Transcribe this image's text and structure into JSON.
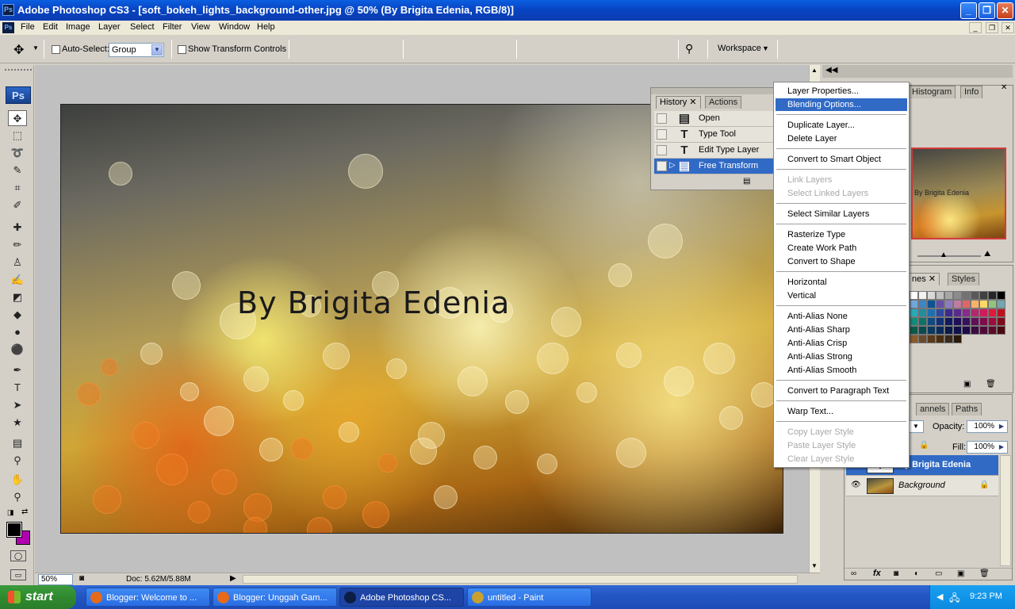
{
  "window": {
    "title": "Adobe Photoshop CS3 - [soft_bokeh_lights_background-other.jpg @ 50% (By Brigita Edenia, RGB/8)]",
    "app_icon_text": "Ps",
    "min_glyph": "_",
    "max_glyph": "❐",
    "close_glyph": "✕"
  },
  "menu": {
    "items": [
      "File",
      "Edit",
      "Image",
      "Layer",
      "Select",
      "Filter",
      "View",
      "Window",
      "Help"
    ],
    "doc_icon_text": "Ps"
  },
  "options": {
    "auto_select_label": "Auto-Select:",
    "auto_select_value": "Group",
    "transform_label": "Show Transform Controls",
    "workspace_label": "Workspace"
  },
  "toolbox": {
    "logo": "Ps",
    "tools": [
      {
        "name": "move-tool",
        "glyph": "✥"
      },
      {
        "name": "marquee-tool",
        "glyph": "⬚"
      },
      {
        "name": "lasso-tool",
        "glyph": "➰"
      },
      {
        "name": "quick-select-tool",
        "glyph": "✎"
      },
      {
        "name": "crop-tool",
        "glyph": "⌗"
      },
      {
        "name": "slice-tool",
        "glyph": "✐"
      },
      {
        "name": "healing-tool",
        "glyph": "✚"
      },
      {
        "name": "brush-tool",
        "glyph": "✏"
      },
      {
        "name": "stamp-tool",
        "glyph": "♙"
      },
      {
        "name": "history-brush-tool",
        "glyph": "✍"
      },
      {
        "name": "eraser-tool",
        "glyph": "◩"
      },
      {
        "name": "paint-bucket-tool",
        "glyph": "◆"
      },
      {
        "name": "blur-tool",
        "glyph": "●"
      },
      {
        "name": "dodge-tool",
        "glyph": "⚫"
      },
      {
        "name": "pen-tool",
        "glyph": "✒"
      },
      {
        "name": "type-tool",
        "glyph": "T"
      },
      {
        "name": "path-select-tool",
        "glyph": "➤"
      },
      {
        "name": "shape-tool",
        "glyph": "★"
      },
      {
        "name": "notes-tool",
        "glyph": "▤"
      },
      {
        "name": "eyedropper-tool",
        "glyph": "⚲"
      },
      {
        "name": "hand-tool",
        "glyph": "✋"
      },
      {
        "name": "zoom-tool",
        "glyph": "⚲"
      }
    ],
    "foreground_color": "#000000",
    "background_color": "#b000b0"
  },
  "canvas": {
    "caption": "By Brigita Edenia"
  },
  "status": {
    "zoom": "50%",
    "doc": "Doc: 5.62M/5.88M"
  },
  "history": {
    "tabs": [
      "History",
      "Actions"
    ],
    "close_glyph": "✕",
    "rows": [
      {
        "label": "Open",
        "icon": "▤",
        "selected": false
      },
      {
        "label": "Type Tool",
        "icon": "T",
        "selected": false
      },
      {
        "label": "Edit Type Layer",
        "icon": "T",
        "selected": false
      },
      {
        "label": "Free Transform",
        "icon": "▤",
        "selected": true
      }
    ]
  },
  "context_menu": {
    "items": [
      {
        "label": "Layer Properties...",
        "state": "normal"
      },
      {
        "label": "Blending Options...",
        "state": "selected"
      },
      {
        "sep": true
      },
      {
        "label": "Duplicate Layer...",
        "state": "normal"
      },
      {
        "label": "Delete Layer",
        "state": "normal"
      },
      {
        "sep": true
      },
      {
        "label": "Convert to Smart Object",
        "state": "normal"
      },
      {
        "sep": true
      },
      {
        "label": "Link Layers",
        "state": "disabled"
      },
      {
        "label": "Select Linked Layers",
        "state": "disabled"
      },
      {
        "sep": true
      },
      {
        "label": "Select Similar Layers",
        "state": "normal"
      },
      {
        "sep": true
      },
      {
        "label": "Rasterize Type",
        "state": "normal"
      },
      {
        "label": "Create Work Path",
        "state": "normal"
      },
      {
        "label": "Convert to Shape",
        "state": "normal"
      },
      {
        "sep": true
      },
      {
        "label": "Horizontal",
        "state": "normal"
      },
      {
        "label": "Vertical",
        "state": "normal"
      },
      {
        "sep": true
      },
      {
        "label": "Anti-Alias None",
        "state": "normal"
      },
      {
        "label": "Anti-Alias Sharp",
        "state": "normal"
      },
      {
        "label": "Anti-Alias Crisp",
        "state": "normal"
      },
      {
        "label": "Anti-Alias Strong",
        "state": "normal"
      },
      {
        "label": "Anti-Alias Smooth",
        "state": "normal"
      },
      {
        "sep": true
      },
      {
        "label": "Convert to Paragraph Text",
        "state": "normal"
      },
      {
        "sep": true
      },
      {
        "label": "Warp Text...",
        "state": "normal"
      },
      {
        "sep": true
      },
      {
        "label": "Copy Layer Style",
        "state": "disabled"
      },
      {
        "label": "Paste Layer Style",
        "state": "disabled"
      },
      {
        "label": "Clear Layer Style",
        "state": "disabled"
      }
    ]
  },
  "navigator": {
    "tabs": [
      "Histogram",
      "Info"
    ],
    "thumb_caption": "By Brigita Edenia"
  },
  "swatches": {
    "tabs": [
      "nes",
      "Styles"
    ],
    "close_glyph": "✕",
    "colors": [
      "#ffffff",
      "#f2f2f2",
      "#d9d9d9",
      "#bfbfbf",
      "#a6a6a6",
      "#8c8c8c",
      "#737373",
      "#595959",
      "#404040",
      "#262626",
      "#000000",
      "#6fa8dc",
      "#3d85c6",
      "#0b5394",
      "#674ea7",
      "#8e7cc3",
      "#c27ba0",
      "#e06666",
      "#f6b26b",
      "#ffd966",
      "#93c47d",
      "#76a5af",
      "#2aa8b8",
      "#1f8ea0",
      "#1e6fb0",
      "#2c4aa0",
      "#3d2a90",
      "#5a2a8c",
      "#8a2a8c",
      "#b02a6c",
      "#d01a5a",
      "#e01a3a",
      "#c01020",
      "#148a7a",
      "#10706a",
      "#104a80",
      "#10307a",
      "#101a60",
      "#20105a",
      "#3a1060",
      "#60105a",
      "#800a4a",
      "#a00a3a",
      "#800a1a",
      "#0a5a4a",
      "#0a4a50",
      "#0a3a60",
      "#0a2a5a",
      "#0a1a4a",
      "#10104a",
      "#200a4a",
      "#3a0a40",
      "#500a3a",
      "#600a2a",
      "#4a0a10",
      "#8a5a2a",
      "#6a4a2a",
      "#5a3a1a",
      "#4a3010",
      "#3a2a1a",
      "#2a1a0a"
    ]
  },
  "layers": {
    "tabs": [
      "annels",
      "Paths"
    ],
    "opacity_label": "Opacity:",
    "opacity_value": "100%",
    "fill_label": "Fill:",
    "fill_value": "100%",
    "rows": [
      {
        "name": "By Brigita Edenia",
        "type": "text",
        "selected": true
      },
      {
        "name": "Background",
        "type": "image",
        "selected": false
      }
    ],
    "bottom_icons": [
      "link-icon",
      "fx-icon",
      "mask-icon",
      "adjustment-icon",
      "folder-icon",
      "new-layer-icon",
      "trash-icon"
    ]
  },
  "taskbar": {
    "start_label": "start",
    "buttons": [
      {
        "label": "Blogger: Welcome to ...",
        "icon_color": "#e66a1a",
        "active": false
      },
      {
        "label": "Blogger: Unggah Gam...",
        "icon_color": "#e66a1a",
        "active": false
      },
      {
        "label": "Adobe Photoshop CS...",
        "icon_color": "#0d1e45",
        "active": true
      },
      {
        "label": "untitled - Paint",
        "icon_color": "#c8a030",
        "active": false
      }
    ],
    "clock": "9:23 PM"
  }
}
